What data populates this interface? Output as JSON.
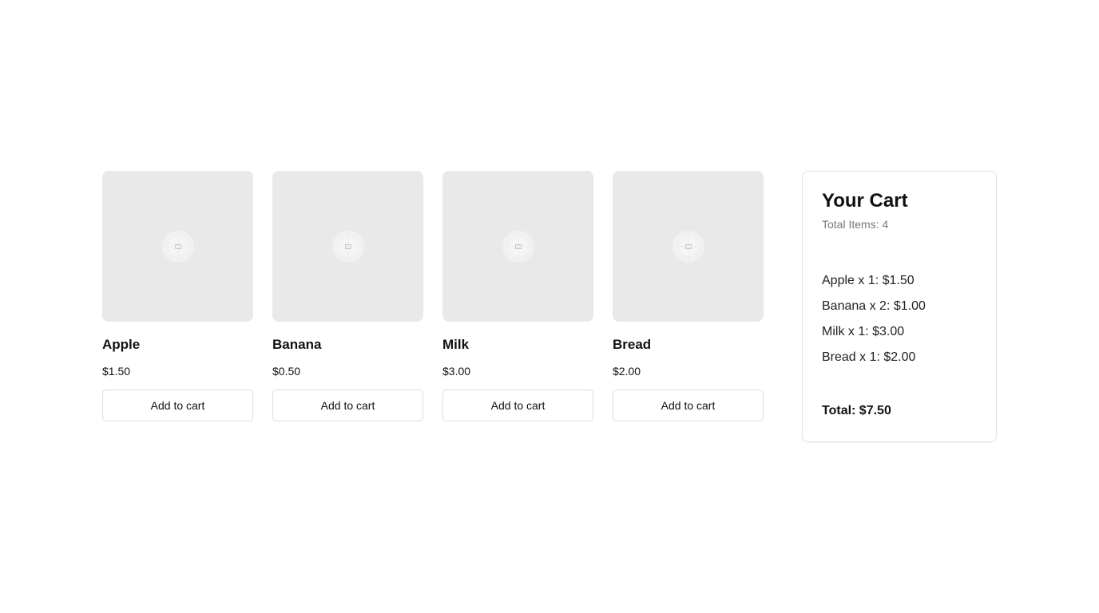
{
  "products": [
    {
      "name": "Apple",
      "price": "$1.50",
      "button_label": "Add to cart",
      "image_icon": "image-placeholder-icon"
    },
    {
      "name": "Banana",
      "price": "$0.50",
      "button_label": "Add to cart",
      "image_icon": "image-placeholder-icon"
    },
    {
      "name": "Milk",
      "price": "$3.00",
      "button_label": "Add to cart",
      "image_icon": "image-placeholder-icon"
    },
    {
      "name": "Bread",
      "price": "$2.00",
      "button_label": "Add to cart",
      "image_icon": "image-placeholder-icon"
    }
  ],
  "cart": {
    "title": "Your Cart",
    "total_items": "Total Items: 4",
    "items": [
      {
        "text": "Apple x 1: $1.50"
      },
      {
        "text": "Banana x 2: $1.00"
      },
      {
        "text": "Milk x 1: $3.00"
      },
      {
        "text": "Bread x 1: $2.00"
      }
    ],
    "total": "Total: $7.50"
  },
  "colors": {
    "image_placeholder_bg": "#e9e9e9",
    "border": "#dddddd",
    "muted_text": "#777777"
  }
}
